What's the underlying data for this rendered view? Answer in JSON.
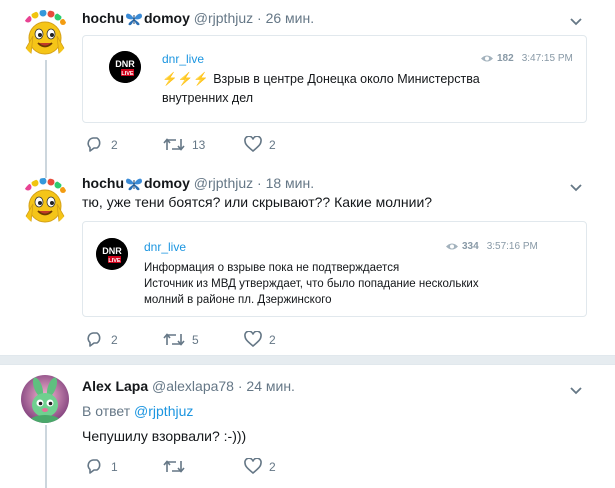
{
  "tweets": [
    {
      "display_name_left": "hochu",
      "display_name_right": "domoy",
      "handle": "@rjpthjuz",
      "dot": "·",
      "time": "26 мин.",
      "quote": {
        "name": "dnr_live",
        "views": "182",
        "time": "3:47:15 PM",
        "logo_text_top": "DNR",
        "logo_text_bottom": "LIVE",
        "bolts": "⚡⚡⚡",
        "line1": "Взрыв в центре Донецка около Министерства",
        "line2": "внутренних дел"
      },
      "actions": {
        "replies": "2",
        "retweets": "13",
        "likes": "2"
      }
    },
    {
      "display_name_left": "hochu",
      "display_name_right": "domoy",
      "handle": "@rjpthjuz",
      "dot": "·",
      "time": "18 мин.",
      "text": "тю, уже тени боятся? или скрывают?? Какие молнии?",
      "quote": {
        "name": "dnr_live",
        "views": "334",
        "time": "3:57:16 PM",
        "logo_text_top": "DNR",
        "logo_text_bottom": "LIVE",
        "line1": "Информация о взрыве пока не подтверждается",
        "line2": "Источник из МВД утверждает, что было попадание нескольких",
        "line3": "молний в районе пл. Дзержинского"
      },
      "actions": {
        "replies": "2",
        "retweets": "5",
        "likes": "2"
      }
    },
    {
      "display_name": "Alex Lapa",
      "handle": "@alexlapa78",
      "dot": "·",
      "time": "24 мин.",
      "reply_prefix": "В ответ",
      "reply_mention": "@rjpthjuz",
      "text": "Чепушилу взорвали? :-)))",
      "actions": {
        "replies": "1",
        "retweets": "",
        "likes": "2"
      }
    }
  ],
  "colors": {
    "accent": "#1b95e0",
    "muted": "#657786",
    "border": "#e1e8ed",
    "divider": "#e6ecf0",
    "bolt": "#f5b301"
  },
  "icons": [
    "emoji-avatar",
    "butterfly-icon",
    "chevron-down-icon",
    "eye-icon",
    "reply-icon",
    "retweet-icon",
    "like-icon",
    "bunny-avatar"
  ]
}
